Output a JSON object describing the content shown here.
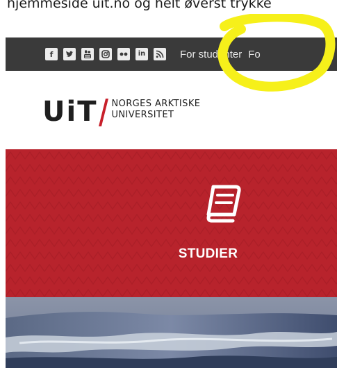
{
  "instruction_text": "hjemmeside uit.no og helt øverst trykke",
  "social_bar": {
    "icons": [
      "facebook-icon",
      "twitter-icon",
      "youtube-icon",
      "instagram-icon",
      "flickr-icon",
      "linkedin-icon",
      "rss-icon"
    ],
    "links": [
      "For studenter",
      "Fo"
    ]
  },
  "logo": {
    "short": "UiT",
    "line1": "NORGES ARKTISKE",
    "line2": "UNIVERSITET"
  },
  "studies": {
    "label": "STUDIER",
    "icon": "book-icon"
  },
  "colors": {
    "bar_bg": "#3a3a3a",
    "brand_red": "#b8232c",
    "highlight": "#f6f01a"
  }
}
